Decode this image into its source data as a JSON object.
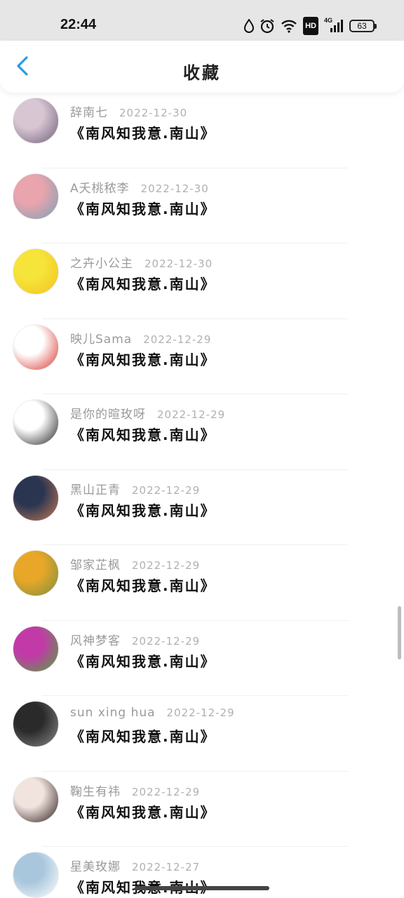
{
  "status_bar": {
    "time": "22:44",
    "hd_label": "HD",
    "network_label": "4G",
    "battery_level": "63"
  },
  "nav": {
    "back_icon": "chevron-left-icon",
    "title": "收藏",
    "accent_color": "#2a9be0"
  },
  "items": [
    {
      "username": "辞南七",
      "date": "2022-12-30",
      "title": "《南风知我意.南山》",
      "avatar_colors": [
        "#d8c6d2",
        "#6e5f7a"
      ]
    },
    {
      "username": "A夭桃秾李",
      "date": "2022-12-30",
      "title": "《南风知我意.南山》",
      "avatar_colors": [
        "#e9a4ad",
        "#7aa0b8"
      ]
    },
    {
      "username": "之卉小公主",
      "date": "2022-12-30",
      "title": "《南风知我意.南山》",
      "avatar_colors": [
        "#f6e43a",
        "#f2c21e"
      ]
    },
    {
      "username": "映儿Sama",
      "date": "2022-12-29",
      "title": "《南风知我意.南山》",
      "avatar_colors": [
        "#ffffff",
        "#d8342c"
      ]
    },
    {
      "username": "是你的暄玫呀",
      "date": "2022-12-29",
      "title": "《南风知我意.南山》",
      "avatar_colors": [
        "#ffffff",
        "#222222"
      ]
    },
    {
      "username": "黑山正青",
      "date": "2022-12-29",
      "title": "《南风知我意.南山》",
      "avatar_colors": [
        "#2a3552",
        "#c67a55"
      ]
    },
    {
      "username": "邹家芷枫",
      "date": "2022-12-29",
      "title": "《南风知我意.南山》",
      "avatar_colors": [
        "#e9a72a",
        "#7b8f3a"
      ]
    },
    {
      "username": "风神梦客",
      "date": "2022-12-29",
      "title": "《南风知我意.南山》",
      "avatar_colors": [
        "#c23aa8",
        "#4fa83a"
      ]
    },
    {
      "username": "sun xing hua",
      "date": "2022-12-29",
      "title": "《南风知我意.南山》",
      "avatar_colors": [
        "#2a2a2a",
        "#8a8a8a"
      ]
    },
    {
      "username": "鞠生有祎",
      "date": "2022-12-29",
      "title": "《南风知我意.南山》",
      "avatar_colors": [
        "#f1e3de",
        "#2a1c1a"
      ]
    },
    {
      "username": "星美玫娜",
      "date": "2022-12-27",
      "title": "《南风知我意.南山》",
      "avatar_colors": [
        "#a8c6dc",
        "#ffffff"
      ]
    }
  ]
}
